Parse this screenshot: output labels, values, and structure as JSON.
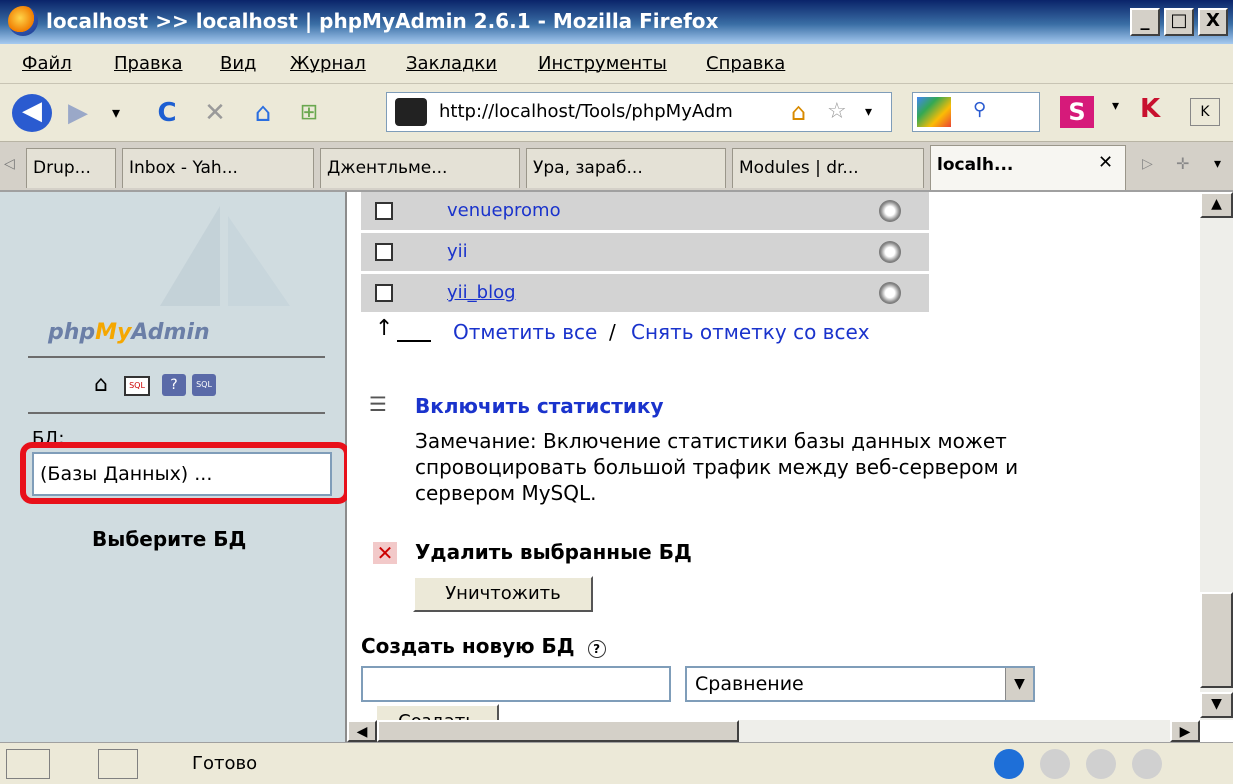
{
  "window": {
    "title": "localhost >> localhost | phpMyAdmin 2.6.1 - Mozilla Firefox",
    "controls": [
      "_",
      "□",
      "X"
    ]
  },
  "menu": [
    "Файл",
    "Правка",
    "Вид",
    "Журнал",
    "Закладки",
    "Инструменты",
    "Справка"
  ],
  "navbar": {
    "url": "http://localhost/Tools/phpMyAdm"
  },
  "tabs": [
    "Drup...",
    "Inbox - Yah...",
    "Джентльме...",
    "Ура, зараб...",
    "Modules | dr...",
    "localh..."
  ],
  "active_tab": "localh...",
  "sidebar": {
    "logo_php": "php",
    "logo_my": "My",
    "logo_admin": "Admin",
    "db_label": "БД:",
    "db_select": "(Базы Данных) ...",
    "pick_label": "Выберите БД"
  },
  "main": {
    "databases": [
      "venuepromo",
      "yii",
      "yii_blog"
    ],
    "check_all": "Отметить все",
    "separator": "/",
    "uncheck_all": "Снять отметку со всех",
    "stats_title": "Включить статистику",
    "stats_note_1": "Замечание: Включение статистики базы данных может",
    "stats_note_2": "спровоцировать большой трафик между веб-сервером и",
    "stats_note_3": "сервером MySQL.",
    "delete_title": "Удалить выбранные БД",
    "delete_button": "Уничтожить",
    "create_title": "Создать новую БД",
    "collation": "Сравнение",
    "create_button": "Создать"
  },
  "status": {
    "text": "Готово"
  },
  "colors": {
    "link": "#1a33cc",
    "highlight": "#e8101a",
    "sidebar_bg": "#d0dce0"
  }
}
